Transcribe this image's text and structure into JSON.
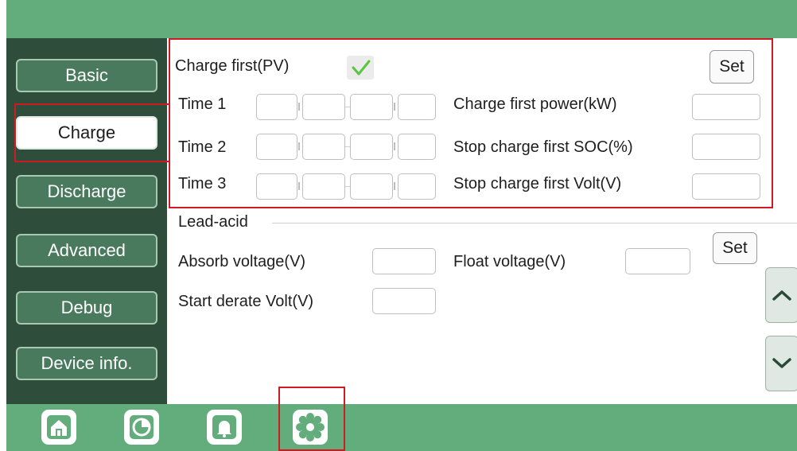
{
  "sidebar": {
    "items": [
      {
        "label": "Basic"
      },
      {
        "label": "Charge"
      },
      {
        "label": "Discharge"
      },
      {
        "label": "Advanced"
      },
      {
        "label": "Debug"
      },
      {
        "label": "Device info."
      }
    ],
    "active": "Charge"
  },
  "charge_first": {
    "label": "Charge first(PV)",
    "checked": true,
    "set_label": "Set",
    "time_labels": [
      "Time 1",
      "Time 2",
      "Time 3"
    ],
    "time_values": [
      [
        "",
        "",
        "",
        ""
      ],
      [
        "",
        "",
        "",
        ""
      ],
      [
        "",
        "",
        "",
        ""
      ]
    ],
    "power_label": "Charge first power(kW)",
    "power_value": "",
    "soc_label": "Stop charge first SOC(%)",
    "soc_value": "",
    "volt_label": "Stop charge first Volt(V)",
    "volt_value": ""
  },
  "lead_acid": {
    "title": "Lead-acid",
    "absorb_label": "Absorb voltage(V)",
    "absorb_value": "",
    "float_label": "Float voltage(V)",
    "float_value": "",
    "derate_label": "Start derate Volt(V)",
    "derate_value": "",
    "set_label": "Set"
  },
  "bottom_tabs": [
    "home-icon",
    "statistics-icon",
    "alarm-icon",
    "settings-icon"
  ],
  "colors": {
    "bar_green": "#63ad7c",
    "sidebar_dark": "#2e4d3a",
    "button_green": "#4a7a5e",
    "highlight_red": "#cc1b22",
    "check_green": "#5ac53e"
  }
}
